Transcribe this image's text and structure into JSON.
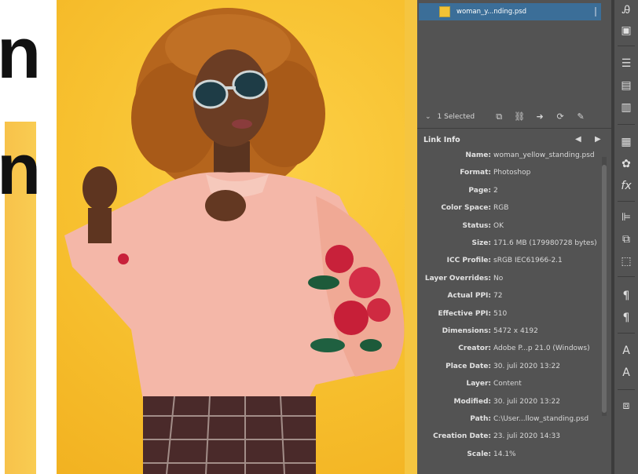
{
  "canvas": {
    "letter_top": "n",
    "letter_bottom": "n"
  },
  "links_panel": {
    "linked_file": "woman_y...nding.psd",
    "selection_count": "1 Selected",
    "link_info_heading": "Link Info",
    "nav_prev": "◀",
    "nav_next": "▶",
    "info": [
      {
        "key": "Name:",
        "value": "woman_yellow_standing.psd"
      },
      {
        "key": "Format:",
        "value": "Photoshop"
      },
      {
        "key": "Page:",
        "value": "2"
      },
      {
        "key": "Color Space:",
        "value": "RGB"
      },
      {
        "key": "Status:",
        "value": "OK"
      },
      {
        "key": "Size:",
        "value": "171.6 MB (179980728 bytes)"
      },
      {
        "key": "ICC Profile:",
        "value": "sRGB IEC61966-2.1"
      },
      {
        "key": "Layer Overrides:",
        "value": "No"
      },
      {
        "key": "Actual PPI:",
        "value": "72"
      },
      {
        "key": "Effective PPI:",
        "value": "510"
      },
      {
        "key": "Dimensions:",
        "value": "5472 x 4192"
      },
      {
        "key": "Creator:",
        "value": "Adobe P...p 21.0 (Windows)"
      },
      {
        "key": "Place Date:",
        "value": "30. juli 2020 13:22"
      },
      {
        "key": "Layer:",
        "value": "Content"
      },
      {
        "key": "Modified:",
        "value": "30. juli 2020 13:22"
      },
      {
        "key": "Path:",
        "value": "C:\\User...llow_standing.psd"
      },
      {
        "key": "Creation Date:",
        "value": "23. juli 2020 14:33"
      },
      {
        "key": "Scale:",
        "value": "14.1%"
      }
    ]
  },
  "colors": {
    "panel_bg": "#535353",
    "selected_row": "#3b6e98",
    "photo_bg": "#f7c02f"
  }
}
